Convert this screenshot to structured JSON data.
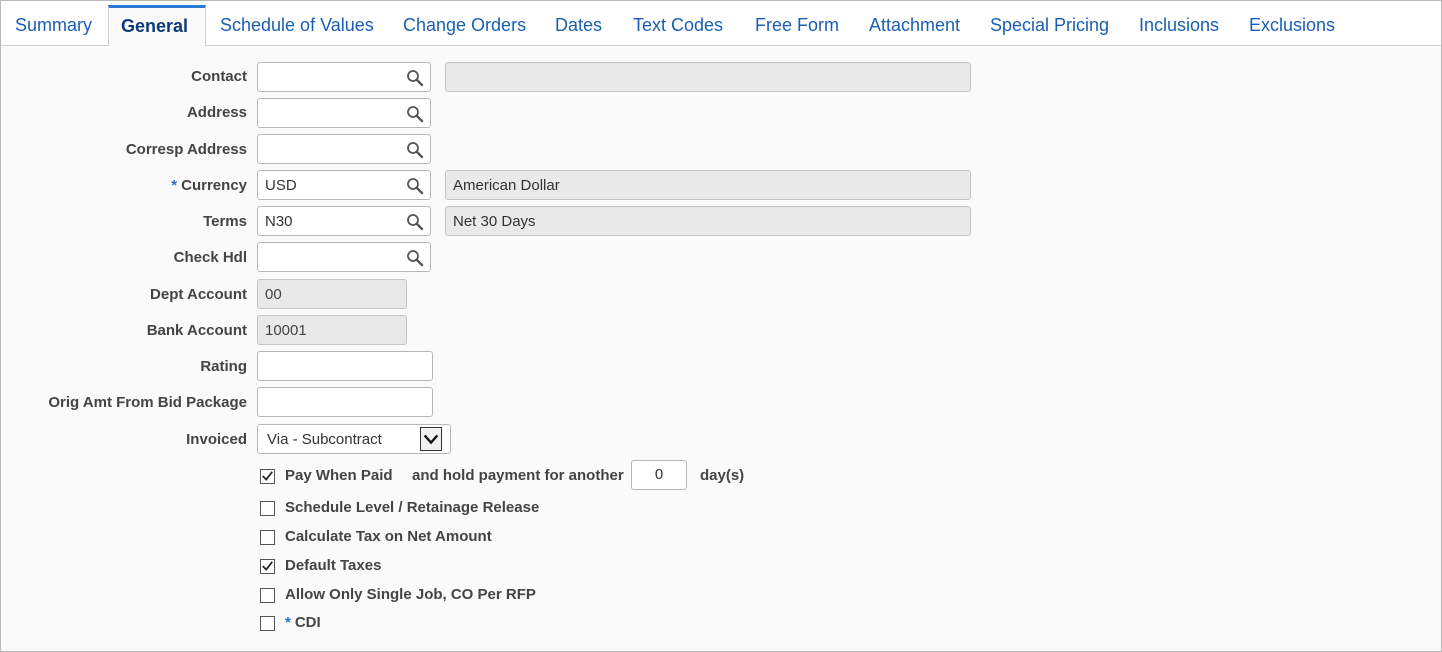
{
  "tabs": [
    {
      "label": "Summary",
      "active": false
    },
    {
      "label": "General",
      "active": true
    },
    {
      "label": "Schedule of Values",
      "active": false
    },
    {
      "label": "Change Orders",
      "active": false
    },
    {
      "label": "Dates",
      "active": false
    },
    {
      "label": "Text Codes",
      "active": false
    },
    {
      "label": "Free Form",
      "active": false
    },
    {
      "label": "Attachment",
      "active": false
    },
    {
      "label": "Special Pricing",
      "active": false
    },
    {
      "label": "Inclusions",
      "active": false
    },
    {
      "label": "Exclusions",
      "active": false
    }
  ],
  "form": {
    "contact": {
      "label": "Contact",
      "value": "",
      "description": ""
    },
    "address": {
      "label": "Address",
      "value": ""
    },
    "corresp_address": {
      "label": "Corresp Address",
      "value": ""
    },
    "currency": {
      "label": "Currency",
      "required_mark": "*",
      "value": "USD",
      "description": "American Dollar"
    },
    "terms": {
      "label": "Terms",
      "value": "N30",
      "description": "Net 30 Days"
    },
    "check_hdl": {
      "label": "Check Hdl",
      "value": ""
    },
    "dept_account": {
      "label": "Dept Account",
      "value": "00"
    },
    "bank_account": {
      "label": "Bank Account",
      "value": "10001"
    },
    "rating": {
      "label": "Rating",
      "value": ""
    },
    "orig_amt": {
      "label": "Orig Amt From Bid Package",
      "value": ""
    },
    "invoiced": {
      "label": "Invoiced",
      "value": "Via - Subcontract"
    }
  },
  "options": {
    "pay_when_paid": {
      "label": "Pay When Paid",
      "checked": true
    },
    "hold_payment_label": "and hold payment for another",
    "hold_days": "0",
    "days_unit": "day(s)",
    "schedule_level": {
      "label": "Schedule Level / Retainage Release",
      "checked": false
    },
    "calc_tax": {
      "label": "Calculate Tax on Net Amount",
      "checked": false
    },
    "default_taxes": {
      "label": "Default Taxes",
      "checked": true
    },
    "single_job": {
      "label": "Allow Only Single Job, CO Per RFP",
      "checked": false
    },
    "cdi": {
      "label": "CDI",
      "required_mark": "*",
      "checked": false
    }
  },
  "icons": {
    "lookup": "magnifier-icon",
    "dropdown": "chevron-down-icon",
    "check": "checkmark-icon"
  },
  "colors": {
    "tab_link": "#1a5fb4",
    "active_tab_border": "#2a77d4",
    "required": "#2a6fc9"
  }
}
